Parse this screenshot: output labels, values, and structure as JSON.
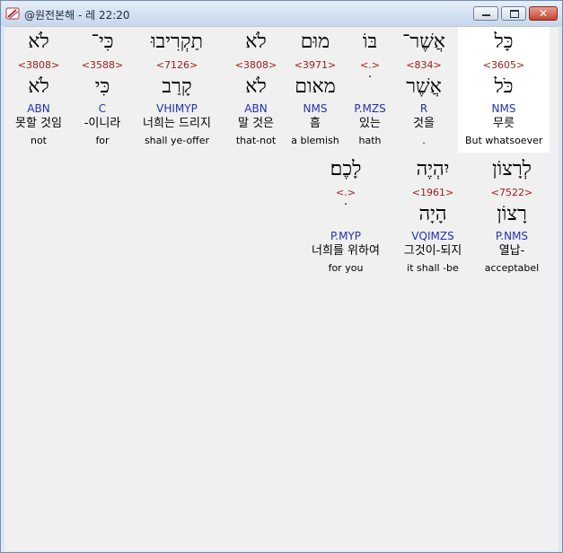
{
  "window": {
    "title": "@원전본해 - 레 22:20",
    "icon": "scroll-app-icon",
    "buttons": {
      "minimize": "minimize-button",
      "maximize": "maximize-button",
      "close": "close-button",
      "close_glyph": "✕"
    }
  },
  "rows": [
    {
      "words": [
        {
          "heb": "כָּל",
          "strong": "<3605>",
          "lemma": "כֹּל",
          "morph": "NMS",
          "korean": "무릇",
          "english": "But whatsoever"
        },
        {
          "heb": "אֲשֶׁר־",
          "strong": "<834>",
          "lemma": "אֲשֶׁר",
          "morph": "R",
          "korean": "것을",
          "english": "."
        },
        {
          "heb": "בּוֹ",
          "strong": "<.>",
          "lemma": "ׄ",
          "morph": "P.MZS",
          "korean": "있는",
          "english": "hath"
        },
        {
          "heb": "מוּם",
          "strong": "<3971>",
          "lemma": "מאום",
          "morph": "NMS",
          "korean": "흠",
          "english": "a blemish"
        },
        {
          "heb": "לֹא",
          "strong": "<3808>",
          "lemma": "לֹא",
          "morph": "ABN",
          "korean": "말 것은",
          "english": "that-not"
        },
        {
          "heb": "תַקְרִיבוּ",
          "strong": "<7126>",
          "lemma": "קָרַב",
          "morph": "VHIMYP",
          "korean": "너희는 드리지",
          "english": "shall ye-offer"
        },
        {
          "heb": "כִּי־",
          "strong": "<3588>",
          "lemma": "כִּי",
          "morph": "C",
          "korean": "-이니라",
          "english": "for"
        },
        {
          "heb": "לֹא",
          "strong": "<3808>",
          "lemma": "לֹא",
          "morph": "ABN",
          "korean": "못할 것임",
          "english": "not"
        }
      ]
    },
    {
      "words": [
        {
          "heb": "לְרָצוֹן",
          "strong": "<7522>",
          "lemma": "רָצוֹן",
          "morph": "P.NMS",
          "korean": "열납-",
          "english": "acceptabel"
        },
        {
          "heb": "יִהְיֶה",
          "strong": "<1961>",
          "lemma": "הָיָה",
          "morph": "VQIMZS",
          "korean": "그것이-되지",
          "english": "it shall -be"
        },
        {
          "heb": "לָכֶם׃",
          "strong": "<.>",
          "lemma": "ׄ",
          "morph": "P.MYP",
          "korean": "너희를 위하여",
          "english": "for you"
        }
      ]
    }
  ]
}
